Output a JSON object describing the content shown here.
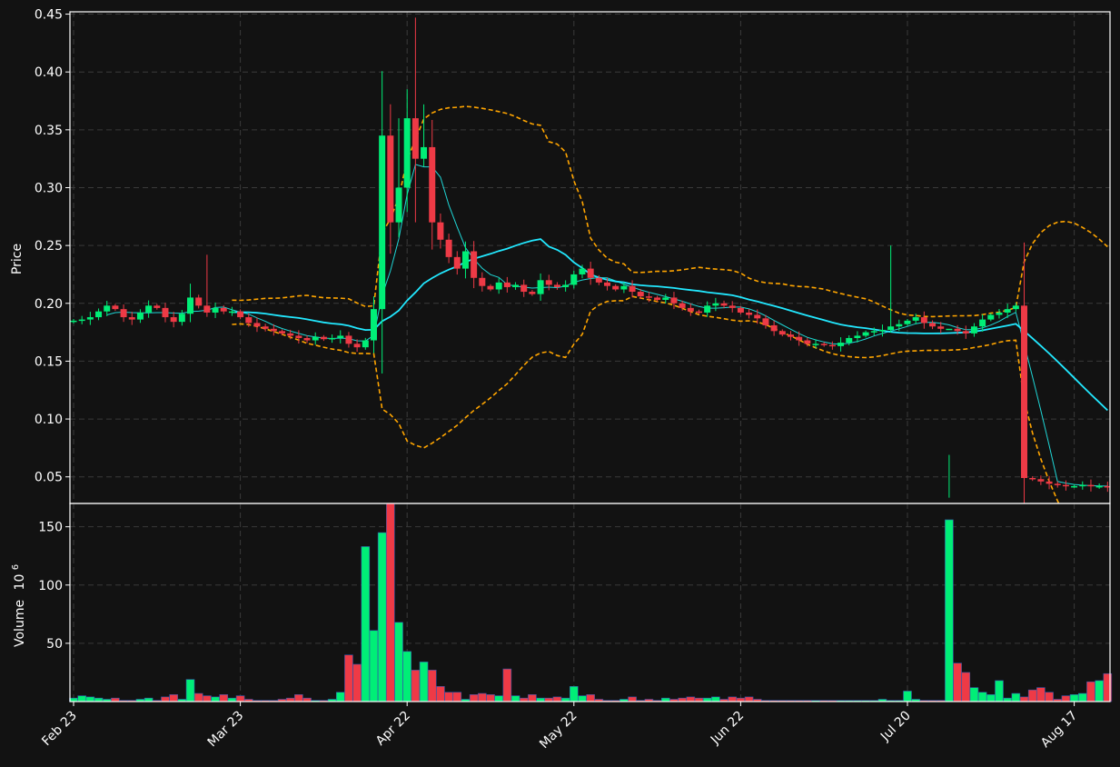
{
  "chart_data": {
    "type": "candlestick",
    "colors": {
      "background": "#121212",
      "up": "#00ee77",
      "down": "#ee3a46",
      "ma_fast": "#1fd6d6",
      "ma_slow": "#22e8ff",
      "bands": "#ffa500",
      "grid": "#3a3a3a",
      "text": "#ffffff"
    },
    "x_tick_labels": [
      "Feb 23",
      "Mar 23",
      "Apr 22",
      "May 22",
      "Jun 22",
      "Jul 20",
      "Aug 17"
    ],
    "x_tick_indices": [
      0,
      20,
      40,
      60,
      80,
      100,
      120
    ],
    "n_bars": 125,
    "price_panel": {
      "ylabel": "Price",
      "ylim": [
        0.027,
        0.452
      ],
      "yticks": [
        0.05,
        0.1,
        0.15,
        0.2,
        0.25,
        0.3,
        0.35,
        0.4,
        0.45
      ],
      "ytick_labels": [
        "0.05",
        "0.10",
        "0.15",
        "0.20",
        "0.25",
        "0.30",
        "0.35",
        "0.40",
        "0.45"
      ]
    },
    "volume_panel": {
      "ylabel": "Volume",
      "ylabel_exponent": "6",
      "ylim": [
        0,
        170
      ],
      "yticks": [
        50,
        100,
        150
      ],
      "ytick_labels": [
        "50",
        "100",
        "150"
      ]
    },
    "closes": [
      0.185,
      0.186,
      0.188,
      0.193,
      0.198,
      0.195,
      0.188,
      0.186,
      0.192,
      0.198,
      0.196,
      0.188,
      0.184,
      0.191,
      0.205,
      0.198,
      0.192,
      0.196,
      0.193,
      0.193,
      0.188,
      0.183,
      0.18,
      0.178,
      0.176,
      0.174,
      0.172,
      0.17,
      0.168,
      0.171,
      0.169,
      0.17,
      0.172,
      0.165,
      0.162,
      0.168,
      0.195,
      0.345,
      0.27,
      0.3,
      0.36,
      0.325,
      0.335,
      0.27,
      0.255,
      0.24,
      0.23,
      0.245,
      0.222,
      0.215,
      0.212,
      0.218,
      0.214,
      0.216,
      0.21,
      0.208,
      0.22,
      0.216,
      0.214,
      0.216,
      0.225,
      0.23,
      0.222,
      0.218,
      0.215,
      0.212,
      0.215,
      0.21,
      0.206,
      0.205,
      0.203,
      0.205,
      0.2,
      0.196,
      0.193,
      0.192,
      0.198,
      0.2,
      0.198,
      0.196,
      0.192,
      0.19,
      0.187,
      0.181,
      0.176,
      0.173,
      0.171,
      0.168,
      0.165,
      0.165,
      0.164,
      0.163,
      0.166,
      0.17,
      0.172,
      0.175,
      0.176,
      0.177,
      0.18,
      0.182,
      0.185,
      0.188,
      0.183,
      0.18,
      0.178,
      0.178,
      0.176,
      0.174,
      0.18,
      0.186,
      0.19,
      0.192,
      0.195,
      0.198,
      0.049,
      0.048,
      0.046,
      0.044,
      0.043,
      0.042,
      0.042,
      0.043,
      0.042,
      0.042,
      0.041
    ],
    "volumes": [
      3,
      5,
      4,
      3,
      2,
      3,
      1,
      1,
      2,
      3,
      1,
      4,
      6,
      2,
      19,
      7,
      5,
      4,
      6,
      3,
      5,
      2,
      1,
      1,
      1,
      2,
      3,
      6,
      3,
      1,
      1,
      2,
      8,
      40,
      32,
      133,
      61,
      145,
      170,
      68,
      43,
      27,
      34,
      27,
      13,
      8,
      8,
      2,
      6,
      7,
      6,
      5,
      28,
      5,
      3,
      6,
      3,
      3,
      4,
      3,
      13,
      5,
      6,
      2,
      1,
      1,
      2,
      4,
      1,
      2,
      1,
      3,
      2,
      3,
      4,
      3,
      3,
      4,
      2,
      4,
      3,
      4,
      2,
      1,
      1,
      1,
      1,
      1,
      1,
      1,
      1,
      1,
      1,
      1,
      1,
      1,
      1,
      2,
      1,
      1,
      9,
      2,
      1,
      1,
      1,
      156,
      33,
      25,
      12,
      8,
      6,
      18,
      3,
      7,
      4,
      10,
      12,
      8,
      2,
      5,
      6,
      7,
      17,
      18,
      24
    ]
  }
}
